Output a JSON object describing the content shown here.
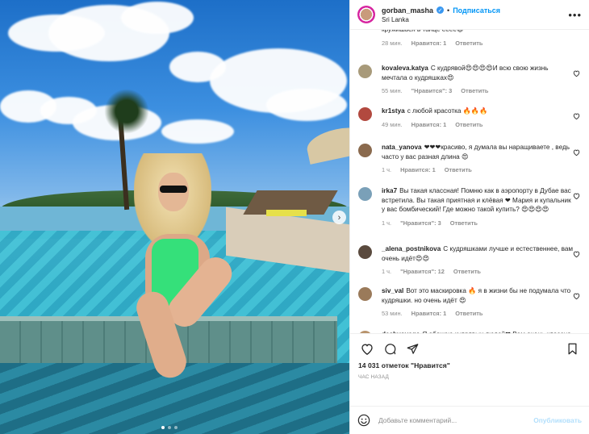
{
  "header": {
    "username": "gorban_masha",
    "follow_label": "Подписаться",
    "location": "Sri Lanka",
    "more": "•••",
    "separator": "•"
  },
  "photo": {
    "next_icon": "›",
    "carousel_total": 3,
    "carousel_active": 1
  },
  "comments": [
    {
      "user": "",
      "text": "кружишься в танце ееее😍",
      "time": "28 мин.",
      "likes": "Нравится: 1",
      "reply": "Ответить",
      "heart": false,
      "avatar_color": "#c99b7b"
    },
    {
      "user": "kovaleva.katya",
      "text": "С кудрявой😍😍😍😍И всю свою жизнь мечтала о кудряшках😍",
      "time": "55 мин.",
      "likes": "\"Нравится\": 3",
      "reply": "Ответить",
      "heart": true,
      "avatar_color": "#a89a7a"
    },
    {
      "user": "kr1stya",
      "text": "с любой красотка 🔥🔥🔥",
      "time": "49 мин.",
      "likes": "Нравится: 1",
      "reply": "Ответить",
      "heart": true,
      "avatar_color": "#b2493f"
    },
    {
      "user": "nata_yanova",
      "text": "❤❤❤красиво, я думала вы наращиваете , ведь часто у вас разная длина 😍",
      "time": "1 ч.",
      "likes": "Нравится: 1",
      "reply": "Ответить",
      "heart": true,
      "avatar_color": "#8a6a4e"
    },
    {
      "user": "irka7",
      "text": "Вы такая классная! Помню как в аэропорту в Дубае вас встретила. Вы такая приятная и клёвая ❤ Мария и купальник у вас бомбический! Где можно такой купить? 😍😍😍😍",
      "time": "1 ч.",
      "likes": "\"Нравится\": 3",
      "reply": "Ответить",
      "heart": true,
      "avatar_color": "#7aa0b8"
    },
    {
      "user": "_alena_postnikova",
      "text": "С кудряшками лучше и естественнее, вам очень идёт😍😍",
      "time": "1 ч.",
      "likes": "\"Нравится\": 12",
      "reply": "Ответить",
      "heart": true,
      "avatar_color": "#5a4a3e"
    },
    {
      "user": "siv_val",
      "text": "Вот это маскировка 🔥 я в жизни бы не подумала что кудряшки. но очень идёт 😍",
      "time": "53 мин.",
      "likes": "Нравится: 1",
      "reply": "Ответить",
      "heart": true,
      "avatar_color": "#9a7a5a"
    },
    {
      "user": "dashvoyage",
      "text": "Я обожаю кудрявых людей❤ Вам очень классно так,лучше,чем с прямыми",
      "time": "",
      "likes": "",
      "reply": "",
      "heart": true,
      "avatar_color": "#b8936c"
    }
  ],
  "actions": {
    "likes_count": "14 031",
    "likes_word": "отметок",
    "likes_suffix": "\"Нравится\"",
    "time_ago": "час назад"
  },
  "add_comment": {
    "placeholder": "Добавьте комментарий...",
    "publish_label": "Опубликовать"
  },
  "icons": {
    "heart": "heart-icon",
    "comment": "comment-icon",
    "share": "share-icon",
    "save": "bookmark-icon",
    "emoji": "smile-icon"
  }
}
